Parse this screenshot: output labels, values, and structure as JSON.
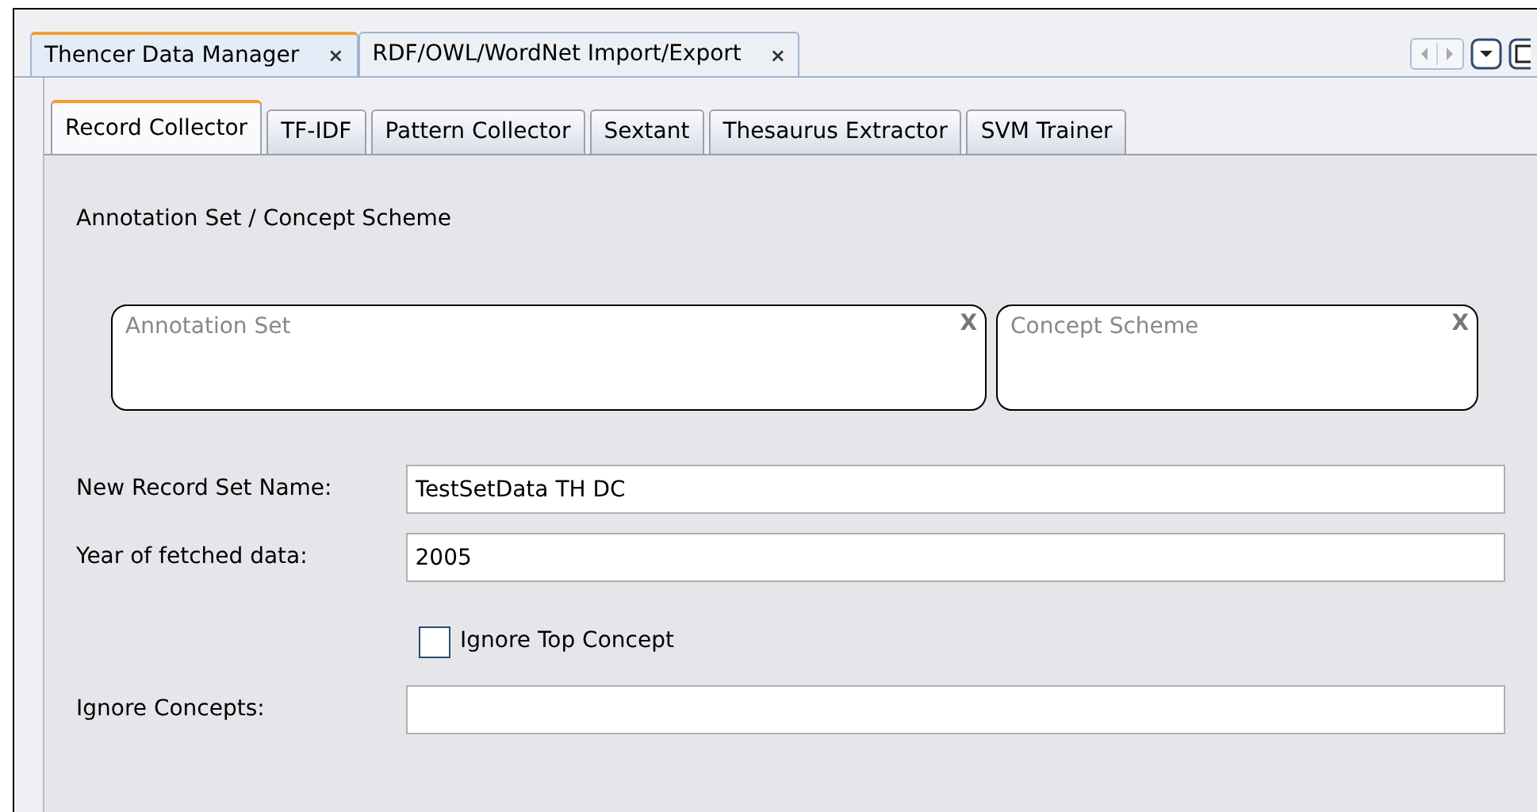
{
  "editor_tabs": [
    {
      "label": "Thencer Data Manager",
      "close": "×",
      "selected": true
    },
    {
      "label": "RDF/OWL/WordNet Import/Export",
      "close": "×",
      "selected": false
    }
  ],
  "tabs": [
    {
      "label": "Record Collector",
      "selected": true
    },
    {
      "label": "TF-IDF",
      "selected": false
    },
    {
      "label": "Pattern Collector",
      "selected": false
    },
    {
      "label": "Sextant",
      "selected": false
    },
    {
      "label": "Thesaurus Extractor",
      "selected": false
    },
    {
      "label": "SVM Trainer",
      "selected": false
    }
  ],
  "section_title": "Annotation Set / Concept Scheme",
  "drop_boxes": [
    {
      "placeholder": "Annotation Set",
      "clear": "X"
    },
    {
      "placeholder": "Concept Scheme",
      "clear": "X"
    }
  ],
  "fields": [
    {
      "label": "New Record Set Name:",
      "value": "TestSetData TH DC"
    },
    {
      "label": "Year of fetched data:",
      "value": "2005"
    }
  ],
  "checkbox": {
    "label": "Ignore Top Concept",
    "checked": false
  },
  "ignore_field": {
    "label": "Ignore Concepts:"
  }
}
